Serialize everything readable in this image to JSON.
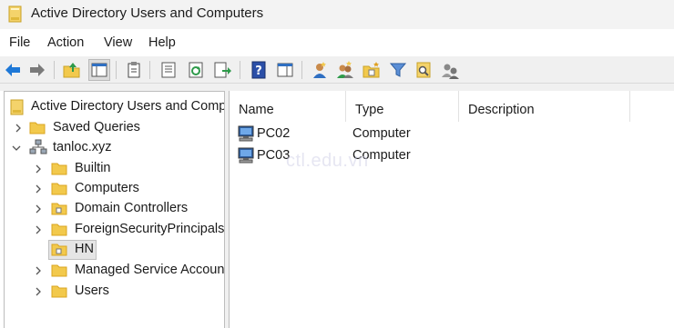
{
  "window": {
    "title": "Active Directory Users and Computers"
  },
  "menu": [
    "File",
    "Action",
    "View",
    "Help"
  ],
  "toolbar": {
    "icons": [
      "back-arrow-icon",
      "forward-arrow-icon",
      "up-folder-icon",
      "show-console-tree-icon",
      "clipboard-icon",
      "properties-icon",
      "refresh-icon",
      "export-list-icon",
      "help-icon",
      "console-view-icon",
      "new-user-icon",
      "new-group-icon",
      "new-ou-icon",
      "filter-icon",
      "find-icon",
      "delegate-control-icon"
    ]
  },
  "tree": {
    "root": "Active Directory Users and Comp",
    "saved_queries": "Saved Queries",
    "domain": "tanloc.xyz",
    "children": [
      "Builtin",
      "Computers",
      "Domain Controllers",
      "ForeignSecurityPrincipals",
      "HN",
      "Managed Service Accoun",
      "Users"
    ],
    "selected": "HN"
  },
  "list": {
    "columns": [
      "Name",
      "Type",
      "Description"
    ],
    "rows": [
      {
        "name": "PC02",
        "type": "Computer",
        "description": ""
      },
      {
        "name": "PC03",
        "type": "Computer",
        "description": ""
      }
    ]
  },
  "watermark": "ctl.edu.vn",
  "colors": {
    "folder": "#f2c94c",
    "folder_dark": "#d9a520",
    "accent_blue": "#1e78d7",
    "selection": "#e5e5e5"
  }
}
